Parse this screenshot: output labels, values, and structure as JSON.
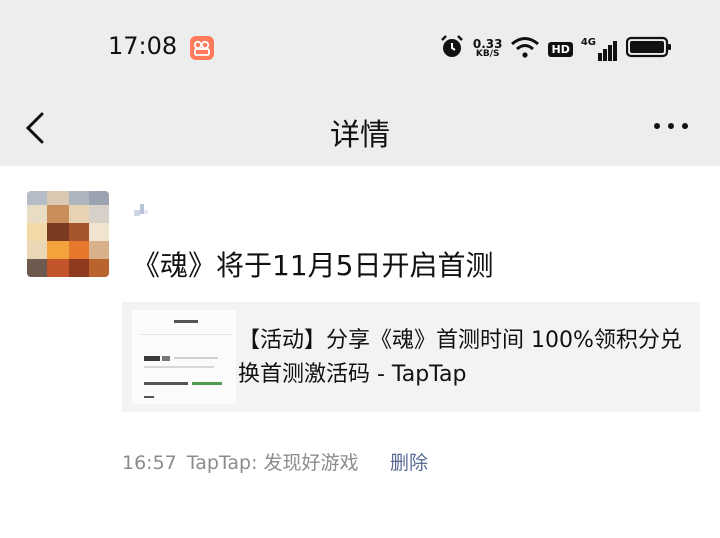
{
  "status_bar": {
    "time": "17:08",
    "network_speed_value": "0.33",
    "network_speed_unit": "KB/S",
    "hd_label": "HD",
    "signal_label": "4G",
    "icons": [
      "app-notification-icon",
      "alarm-icon",
      "wifi-icon",
      "signal-icon",
      "battery-icon"
    ]
  },
  "nav": {
    "title": "详情",
    "back_icon": "chevron-left-icon",
    "more_icon": "more-dots-icon"
  },
  "post": {
    "text": "《魂》将于11月5日开启首测",
    "link": {
      "title": "【活动】分享《魂》首测时间 100%领积分兑换首测激活码 - TapTap"
    },
    "time": "16:57",
    "source": "TapTap: 发现好游戏",
    "delete_label": "删除"
  },
  "colors": {
    "bar_background": "#ededed",
    "link_card_background": "#f3f3f3",
    "meta_text": "#8c8c8c",
    "action_link": "#576b95"
  }
}
